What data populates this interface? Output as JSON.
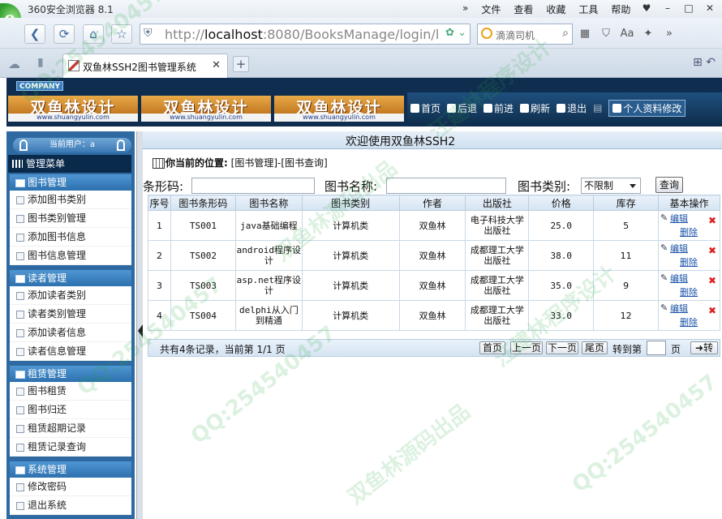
{
  "browser": {
    "title": "360安全浏览器 8.1",
    "menu": [
      "»",
      "文件",
      "查看",
      "收藏",
      "工具",
      "帮助"
    ],
    "window_controls": [
      "♥",
      "–",
      "□",
      "✕"
    ],
    "address_prefix": "http://",
    "address_host": "localhost",
    "address_rest": ":8080/BooksManage/login/l",
    "search_placeholder": "滴滴司机",
    "tab_title": "双鱼林SSH2图书管理系统"
  },
  "header": {
    "company": "COMPANY",
    "banner_text": "双鱼林设计",
    "banner_sub": "www.shuangyulin.com",
    "nav": [
      "首页",
      "后退",
      "前进",
      "刷新",
      "退出"
    ],
    "profile": "个人资料修改"
  },
  "sidebar": {
    "current_user": "当前用户：a",
    "root": "管理菜单",
    "groups": [
      {
        "title": "图书管理",
        "items": [
          "添加图书类别",
          "图书类别管理",
          "添加图书信息",
          "图书信息管理"
        ]
      },
      {
        "title": "读者管理",
        "items": [
          "添加读者类别",
          "读者类别管理",
          "添加读者信息",
          "读者信息管理"
        ]
      },
      {
        "title": "租赁管理",
        "items": [
          "图书租赁",
          "图书归还",
          "租赁超期记录",
          "租赁记录查询"
        ]
      },
      {
        "title": "系统管理",
        "items": [
          "修改密码",
          "退出系统"
        ]
      }
    ]
  },
  "main": {
    "welcome": "欢迎使用双鱼林SSH2",
    "crumb_label": "你当前的位置:",
    "crumb_path": "[图书管理]-[图书查询]",
    "filters": {
      "barcode_label": "条形码:",
      "name_label": "图书名称:",
      "type_label": "图书类别:",
      "type_value": "不限制",
      "query_button": "查询"
    },
    "table": {
      "headers": [
        "序号",
        "图书条形码",
        "图书名称",
        "图书类别",
        "作者",
        "出版社",
        "价格",
        "库存",
        "基本操作"
      ],
      "rows": [
        {
          "no": "1",
          "barcode": "TS001",
          "name": "java基础编程",
          "type": "计算机类",
          "author": "双鱼林",
          "publisher": "电子科技大学出版社",
          "price": "25.0",
          "stock": "5"
        },
        {
          "no": "2",
          "barcode": "TS002",
          "name": "android程序设计",
          "type": "计算机类",
          "author": "双鱼林",
          "publisher": "成都理工大学出版社",
          "price": "38.0",
          "stock": "11"
        },
        {
          "no": "3",
          "barcode": "TS003",
          "name": "asp.net程序设计",
          "type": "计算机类",
          "author": "双鱼林",
          "publisher": "成都理工大学出版社",
          "price": "35.0",
          "stock": "9"
        },
        {
          "no": "4",
          "barcode": "TS004",
          "name": "delphi从入门到精通",
          "type": "计算机类",
          "author": "双鱼林",
          "publisher": "成都理工大学出版社",
          "price": "33.0",
          "stock": "12"
        }
      ],
      "edit_label": "编辑",
      "delete_label": "删除"
    },
    "pager": {
      "info": "共有4条记录，当前第 1/1 页",
      "first": "首页",
      "prev": "上一页",
      "next": "下一页",
      "last": "尾页",
      "goto_label": "转到第",
      "page_unit": "页",
      "go": "➜转"
    }
  },
  "watermarks": [
    "QQ:254540457",
    "双鱼林源码出品",
    "汪建林程序设计"
  ]
}
